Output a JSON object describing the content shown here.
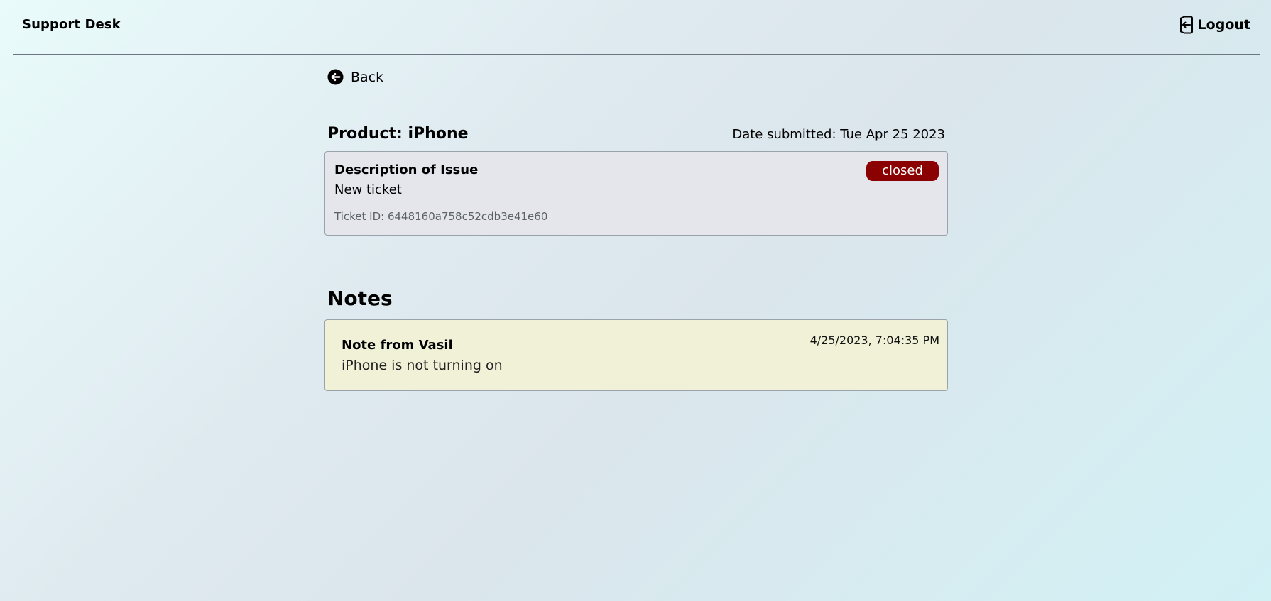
{
  "header": {
    "brand": "Support Desk",
    "logout_label": "Logout"
  },
  "nav": {
    "back_label": "Back"
  },
  "ticket": {
    "product_title": "Product: iPhone",
    "date_submitted": "Date submitted: Tue Apr 25 2023",
    "description_heading": "Description of Issue",
    "description": "New ticket",
    "status": "closed",
    "ticket_id": "Ticket ID: 6448160a758c52cdb3e41e60"
  },
  "notes": {
    "heading": "Notes",
    "items": [
      {
        "author": "Note from Vasil",
        "text": "iPhone is not turning on",
        "timestamp": "4/25/2023, 7:04:35 PM"
      }
    ]
  },
  "colors": {
    "status_closed": "#8b0000",
    "issue_card_bg": "#e4e6ec",
    "note_card_bg": "#f1f1d8"
  },
  "icons": {
    "logout": "logout-icon",
    "back": "arrow-circle-left-icon"
  }
}
